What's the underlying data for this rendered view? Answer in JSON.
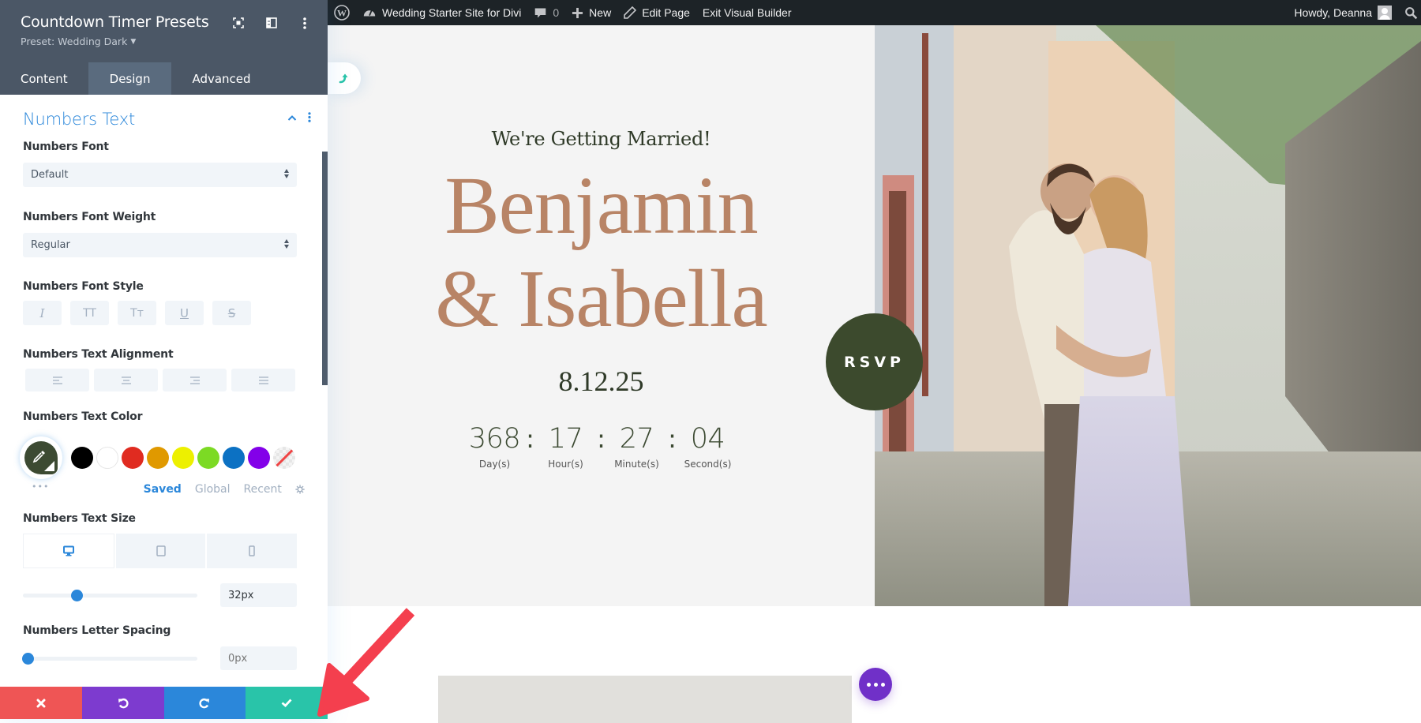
{
  "adminbar": {
    "site_name": "Wedding Starter Site for Divi",
    "comment_count": "0",
    "new_label": "New",
    "edit_page_label": "Edit Page",
    "exit_builder_label": "Exit Visual Builder",
    "howdy_label": "Howdy, Deanna"
  },
  "panel": {
    "title": "Countdown Timer Presets",
    "preset_label": "Preset: Wedding Dark",
    "tabs": [
      {
        "label": "Content",
        "active": false
      },
      {
        "label": "Design",
        "active": true
      },
      {
        "label": "Advanced",
        "active": false
      }
    ],
    "group_title": "Numbers Text",
    "fields": {
      "font": {
        "label": "Numbers Font",
        "value": "Default"
      },
      "weight": {
        "label": "Numbers Font Weight",
        "value": "Regular"
      },
      "style": {
        "label": "Numbers Font Style",
        "buttons": [
          "italic",
          "uppercase",
          "capitalize",
          "underline",
          "strikethrough"
        ],
        "glyphs": [
          "I",
          "TT",
          "Tт",
          "U",
          "S"
        ]
      },
      "alignment": {
        "label": "Numbers Text Alignment",
        "options": [
          "left",
          "center",
          "right",
          "justify"
        ]
      },
      "color": {
        "label": "Numbers Text Color",
        "current": "#3c4a32",
        "swatches": [
          "#000000",
          "#ffffff",
          "#e02b20",
          "#e09900",
          "#edf000",
          "#7cda24",
          "#0c71c3",
          "#8300e9",
          "none"
        ],
        "tabs": [
          {
            "label": "Saved",
            "active": true
          },
          {
            "label": "Global",
            "active": false
          },
          {
            "label": "Recent",
            "active": false
          }
        ]
      },
      "size": {
        "label": "Numbers Text Size",
        "devices": [
          "desktop",
          "tablet",
          "phone"
        ],
        "active_device": "desktop",
        "value": "32px",
        "slider_fraction": 0.31
      },
      "letter_spacing": {
        "label": "Numbers Letter Spacing",
        "value": "",
        "placeholder": "0px",
        "slider_fraction": 0.0
      }
    },
    "actions": [
      {
        "name": "discard",
        "color": "#ef5555"
      },
      {
        "name": "undo",
        "color": "#7d3bcf"
      },
      {
        "name": "redo",
        "color": "#2b87da"
      },
      {
        "name": "save",
        "color": "#29c4a9"
      }
    ]
  },
  "page": {
    "eyebrow": "We're Getting Married!",
    "name_line1": "Benjamin",
    "name_line2": "& Isabella",
    "date": "8.12.25",
    "countdown": [
      {
        "value": "368",
        "label": "Day(s)"
      },
      {
        "value": "17",
        "label": "Hour(s)"
      },
      {
        "value": "27",
        "label": "Minute(s)"
      },
      {
        "value": "04",
        "label": "Second(s)"
      }
    ],
    "separator": ":",
    "rsvp_label": "RSVP",
    "colors": {
      "accent_brown": "#b88466",
      "accent_green": "#3c4a2d"
    }
  }
}
